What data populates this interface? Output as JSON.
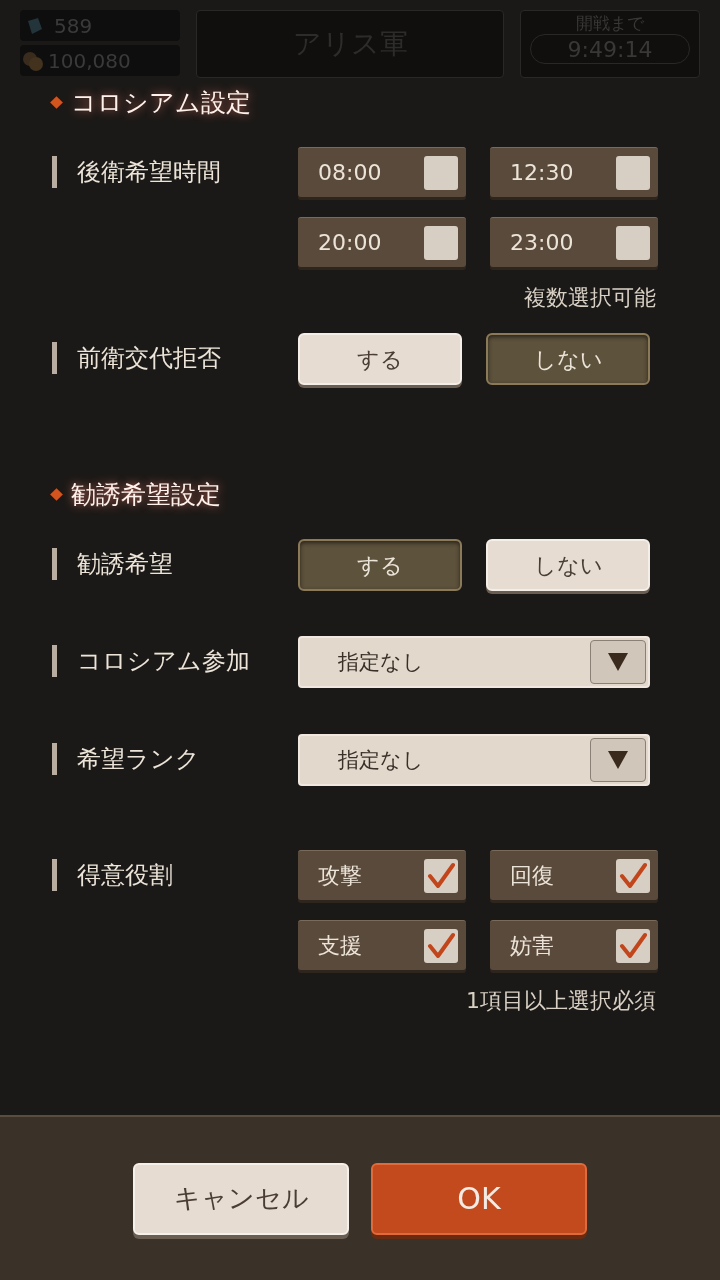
{
  "top_bar": {
    "gems": "589",
    "coins": "100,080",
    "guild_name": "アリス軍",
    "countdown_label": "開戦まで",
    "countdown": "9:49:14"
  },
  "sections": [
    {
      "title": "コロシアム設定",
      "rows": [
        {
          "kind": "checks",
          "label": "後衛希望時間",
          "options": [
            {
              "label": "08:00",
              "checked": false
            },
            {
              "label": "12:30",
              "checked": false
            },
            {
              "label": "20:00",
              "checked": false
            },
            {
              "label": "23:00",
              "checked": false
            }
          ],
          "note": "複数選択可能"
        },
        {
          "kind": "toggle",
          "label": "前衛交代拒否",
          "options": [
            {
              "label": "する",
              "selected": false
            },
            {
              "label": "しない",
              "selected": true
            }
          ]
        }
      ]
    },
    {
      "title": "勧誘希望設定",
      "rows": [
        {
          "kind": "toggle",
          "label": "勧誘希望",
          "options": [
            {
              "label": "する",
              "selected": true
            },
            {
              "label": "しない",
              "selected": false
            }
          ]
        },
        {
          "kind": "dropdown",
          "label": "コロシアム参加",
          "value": "指定なし"
        },
        {
          "kind": "dropdown",
          "label": "希望ランク",
          "value": "指定なし"
        },
        {
          "kind": "checks",
          "label": "得意役割",
          "options": [
            {
              "label": "攻撃",
              "checked": true
            },
            {
              "label": "回復",
              "checked": true
            },
            {
              "label": "支援",
              "checked": true
            },
            {
              "label": "妨害",
              "checked": true
            }
          ],
          "note": "1項目以上選択必須"
        }
      ]
    }
  ],
  "buttons": [
    {
      "label": "キャンセル",
      "kind": "secondary"
    },
    {
      "label": "OK",
      "kind": "primary"
    }
  ]
}
